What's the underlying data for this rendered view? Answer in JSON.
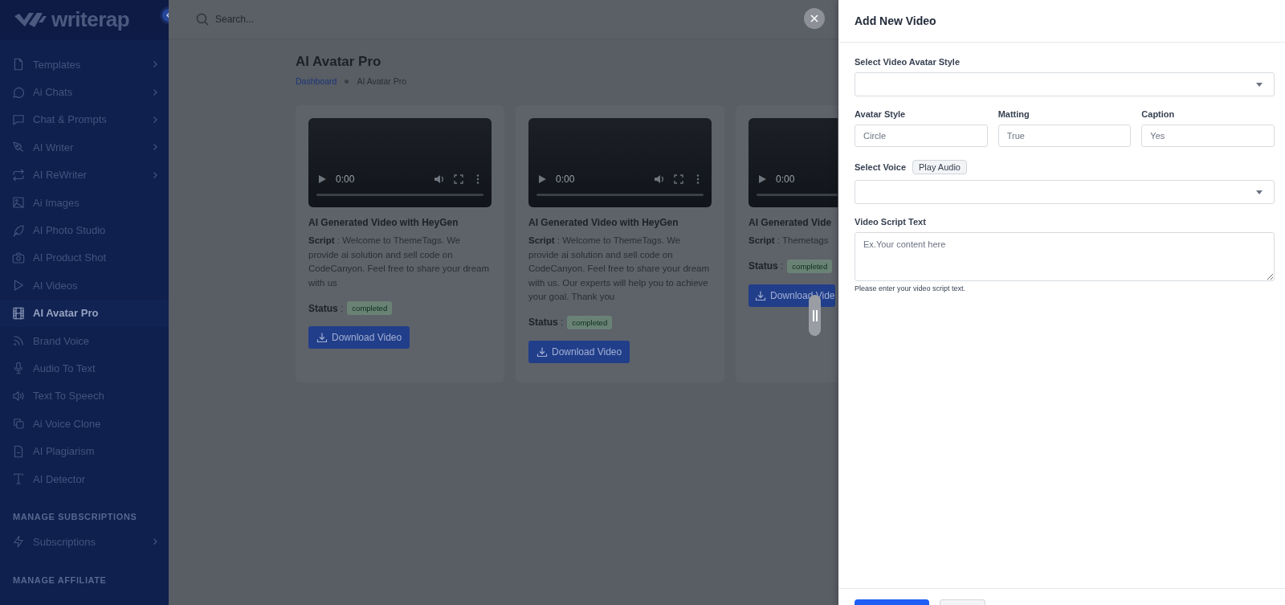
{
  "brand": {
    "name": "writerap"
  },
  "sidebar": {
    "groups": [
      {
        "items": [
          {
            "label": "Templates",
            "selected": false,
            "expandable": true
          },
          {
            "label": "Ai Chats",
            "selected": false,
            "expandable": true
          },
          {
            "label": "Chat & Prompts",
            "selected": false,
            "expandable": true
          },
          {
            "label": "AI Writer",
            "selected": false,
            "expandable": true
          },
          {
            "label": "AI ReWriter",
            "selected": false,
            "expandable": true
          },
          {
            "label": "Ai Images",
            "selected": false,
            "expandable": false
          },
          {
            "label": "AI Photo Studio",
            "selected": false,
            "expandable": false
          },
          {
            "label": "AI Product Shot",
            "selected": false,
            "expandable": false
          },
          {
            "label": "AI Videos",
            "selected": false,
            "expandable": false
          },
          {
            "label": "AI Avatar Pro",
            "selected": true,
            "expandable": false
          },
          {
            "label": "Brand Voice",
            "selected": false,
            "expandable": false
          },
          {
            "label": "Audio To Text",
            "selected": false,
            "expandable": false
          },
          {
            "label": "Text To Speech",
            "selected": false,
            "expandable": false
          },
          {
            "label": "Ai Voice Clone",
            "selected": false,
            "expandable": false
          },
          {
            "label": "AI Plagiarism",
            "selected": false,
            "expandable": false
          },
          {
            "label": "AI Detector",
            "selected": false,
            "expandable": false
          }
        ]
      },
      {
        "heading": "MANAGE SUBSCRIPTIONS",
        "items": [
          {
            "label": "Subscriptions",
            "selected": false,
            "expandable": true
          }
        ]
      },
      {
        "heading": "MANAGE AFFILIATE"
      }
    ]
  },
  "search": {
    "placeholder": "Search..."
  },
  "page": {
    "title": "AI Avatar Pro",
    "breadcrumb": [
      {
        "label": "Dashboard",
        "kind": "link"
      },
      {
        "label": "AI Avatar Pro",
        "kind": "current"
      }
    ]
  },
  "cards": [
    {
      "video": {
        "time": "0:00",
        "cropped": false
      },
      "title": "AI Generated Video with HeyGen",
      "script": "**Script** : Welcome to ThemeTags. We provide ai solution and sell code on CodeCanyon. Feel free to share your dream with us",
      "status_label": "**Status** :",
      "status": "completed",
      "button": "Download Video"
    },
    {
      "video": {
        "time": "0:00",
        "cropped": false
      },
      "title": "AI Generated Video with HeyGen",
      "script": "**Script** : Welcome to ThemeTags. We provide ai solution and sell code on CodeCanyon. Feel free to share your dream with us. Our experts will help you to achieve your goal. Thank you",
      "status_label": "**Status** :",
      "status": "completed",
      "button": "Download Video"
    },
    {
      "video": {
        "time": "0:00",
        "cropped": true
      },
      "title": "AI Generated Vide",
      "script": "**Script** : Themetags",
      "status_label": "**Status** :",
      "status": "completed",
      "button": "Download Vide"
    }
  ],
  "drawer": {
    "title": "Add New Video",
    "fields": [
      {
        "kind": "select",
        "label": "Select Video Avatar Style"
      },
      {
        "kind": "row",
        "fields": [
          {
            "label": "Avatar Style",
            "placeholder": "Circle"
          },
          {
            "label": "Matting",
            "placeholder": "True"
          },
          {
            "label": "Caption",
            "placeholder": "Yes"
          }
        ]
      },
      {
        "kind": "select",
        "label": "Select Voice",
        "action": "Play Audio"
      },
      {
        "kind": "textarea",
        "label": "Video Script Text",
        "placeholder": "Ex.Your content here",
        "help": "Please enter your video script text."
      }
    ],
    "buttons": [
      {
        "kind": "primary"
      },
      {
        "kind": "secondary"
      }
    ]
  }
}
